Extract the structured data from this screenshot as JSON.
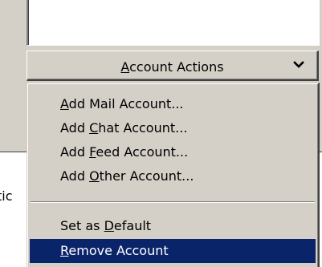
{
  "background_fragment": "tic",
  "dropdown": {
    "label_mnemonic": "A",
    "label_rest": "ccount Actions",
    "icon": "chevron-down-icon"
  },
  "menu": {
    "items": [
      {
        "pre": "",
        "key": "A",
        "post": "dd Mail Account..."
      },
      {
        "pre": "Add ",
        "key": "C",
        "post": "hat Account..."
      },
      {
        "pre": "Add ",
        "key": "F",
        "post": "eed Account..."
      },
      {
        "pre": "Add ",
        "key": "O",
        "post": "ther Account..."
      },
      {
        "pre": "Set as ",
        "key": "D",
        "post": "efault"
      },
      {
        "pre": "",
        "key": "R",
        "post": "emove Account",
        "selected": true
      }
    ]
  },
  "colors": {
    "dialog_face": "#d4d0c8",
    "selection": "#0a246a",
    "selection_text": "#ffffff"
  }
}
